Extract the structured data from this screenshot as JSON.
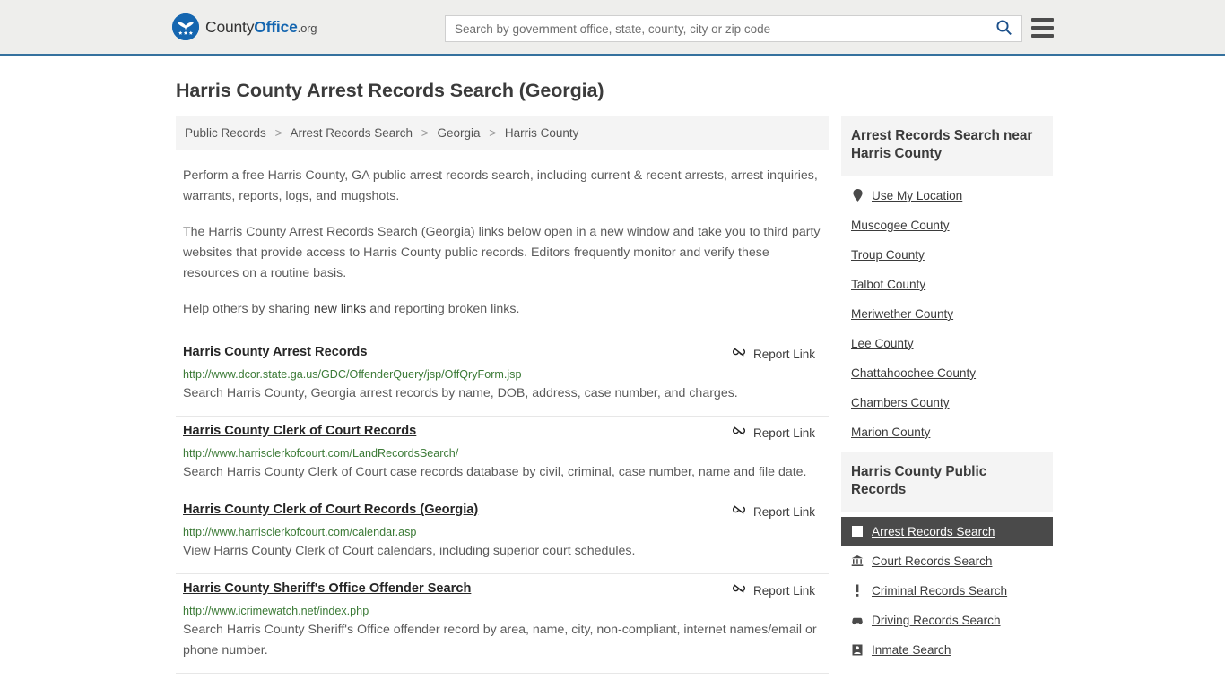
{
  "header": {
    "logo": {
      "name_part1": "County",
      "name_part2": "Office",
      "tld": ".org",
      "mark_icon": "eagle-seal-icon",
      "brand_color": "#1566b0"
    },
    "search": {
      "placeholder": "Search by government office, state, county, city or zip code",
      "value": "",
      "icon": "search-icon",
      "icon_color": "#1b4f8a"
    },
    "menu_icon": "hamburger-menu-icon",
    "border_color": "#35719e"
  },
  "page": {
    "title": "Harris County Arrest Records Search (Georgia)"
  },
  "breadcrumb": {
    "items": [
      {
        "label": "Public Records"
      },
      {
        "label": "Arrest Records Search"
      },
      {
        "label": "Georgia"
      },
      {
        "label": "Harris County"
      }
    ],
    "separator": ">"
  },
  "intro": {
    "p1": "Perform a free Harris County, GA public arrest records search, including current & recent arrests, arrest inquiries, warrants, reports, logs, and mugshots.",
    "p2": "The Harris County Arrest Records Search (Georgia) links below open in a new window and take you to third party websites that provide access to Harris County public records. Editors frequently monitor and verify these resources on a routine basis.",
    "p3_before": "Help others by sharing ",
    "p3_link": "new links",
    "p3_after": " and reporting broken links."
  },
  "results": {
    "report_label": "Report Link",
    "report_icon": "broken-link-icon",
    "items": [
      {
        "title": "Harris County Arrest Records",
        "url": "http://www.dcor.state.ga.us/GDC/OffenderQuery/jsp/OffQryForm.jsp",
        "description": "Search Harris County, Georgia arrest records by name, DOB, address, case number, and charges."
      },
      {
        "title": "Harris County Clerk of Court Records",
        "url": "http://www.harrisclerkofcourt.com/LandRecordsSearch/",
        "description": "Search Harris County Clerk of Court case records database by civil, criminal, case number, name and file date."
      },
      {
        "title": "Harris County Clerk of Court Records (Georgia)",
        "url": "http://www.harrisclerkofcourt.com/calendar.asp",
        "description": "View Harris County Clerk of Court calendars, including superior court schedules."
      },
      {
        "title": "Harris County Sheriff's Office Offender Search",
        "url": "http://www.icrimewatch.net/index.php",
        "description": "Search Harris County Sheriff's Office offender record by area, name, city, non-compliant, internet names/email or phone number."
      }
    ]
  },
  "sidebar": {
    "nearby": {
      "heading": "Arrest Records Search near Harris County",
      "items": [
        {
          "label": "Use My Location",
          "icon": "map-pin-icon"
        },
        {
          "label": "Muscogee County",
          "icon": ""
        },
        {
          "label": "Troup County",
          "icon": ""
        },
        {
          "label": "Talbot County",
          "icon": ""
        },
        {
          "label": "Meriwether County",
          "icon": ""
        },
        {
          "label": "Lee County",
          "icon": ""
        },
        {
          "label": "Chattahoochee County",
          "icon": ""
        },
        {
          "label": "Chambers County",
          "icon": ""
        },
        {
          "label": "Marion County",
          "icon": ""
        }
      ]
    },
    "public_records": {
      "heading": "Harris County Public Records",
      "items": [
        {
          "label": "Arrest Records Search",
          "icon": "arrest-records-icon",
          "active": true
        },
        {
          "label": "Court Records Search",
          "icon": "courthouse-icon",
          "active": false
        },
        {
          "label": "Criminal Records Search",
          "icon": "exclamation-icon",
          "active": false
        },
        {
          "label": "Driving Records Search",
          "icon": "car-icon",
          "active": false
        },
        {
          "label": "Inmate Search",
          "icon": "inmate-icon",
          "active": false
        }
      ],
      "active_bg": "#4a4a4a"
    }
  }
}
